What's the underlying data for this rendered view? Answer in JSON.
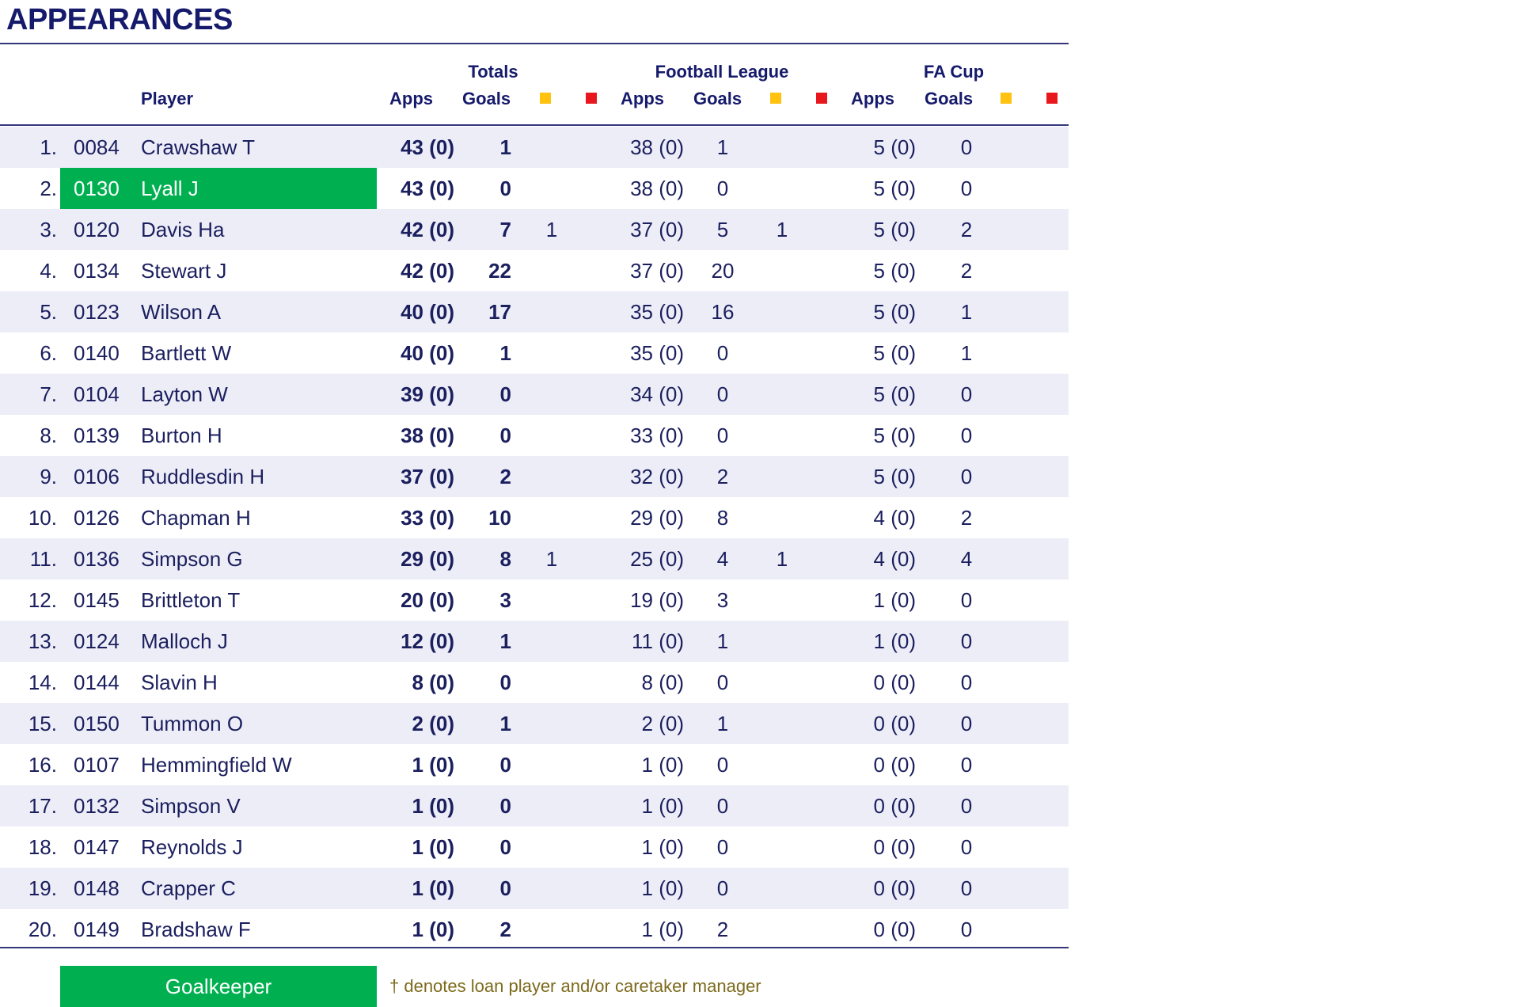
{
  "title": "APPEARANCES",
  "headers": {
    "player": "Player",
    "totals": "Totals",
    "league": "Football League",
    "cup": "FA Cup",
    "apps": "Apps",
    "goals": "Goals"
  },
  "colors": {
    "goalkeeper_band": "#00b050",
    "yellow_card": "#ffc20e",
    "red_card": "#e8171e",
    "text": "#1b1f5e",
    "row_alt": "#ededf8"
  },
  "rows": [
    {
      "rank": "1.",
      "code": "0084",
      "name": "Crawshaw T",
      "total_apps": "43 (0)",
      "total_goals": "1",
      "total_yellow": "",
      "league_apps": "38 (0)",
      "league_goals": "1",
      "league_yellow": "",
      "cup_apps": "5 (0)",
      "cup_goals": "0",
      "goalkeeper": false
    },
    {
      "rank": "2.",
      "code": "0130",
      "name": "Lyall J",
      "total_apps": "43 (0)",
      "total_goals": "0",
      "total_yellow": "",
      "league_apps": "38 (0)",
      "league_goals": "0",
      "league_yellow": "",
      "cup_apps": "5 (0)",
      "cup_goals": "0",
      "goalkeeper": true
    },
    {
      "rank": "3.",
      "code": "0120",
      "name": "Davis Ha",
      "total_apps": "42 (0)",
      "total_goals": "7",
      "total_yellow": "1",
      "league_apps": "37 (0)",
      "league_goals": "5",
      "league_yellow": "1",
      "cup_apps": "5 (0)",
      "cup_goals": "2",
      "goalkeeper": false
    },
    {
      "rank": "4.",
      "code": "0134",
      "name": "Stewart J",
      "total_apps": "42 (0)",
      "total_goals": "22",
      "total_yellow": "",
      "league_apps": "37 (0)",
      "league_goals": "20",
      "league_yellow": "",
      "cup_apps": "5 (0)",
      "cup_goals": "2",
      "goalkeeper": false
    },
    {
      "rank": "5.",
      "code": "0123",
      "name": "Wilson A",
      "total_apps": "40 (0)",
      "total_goals": "17",
      "total_yellow": "",
      "league_apps": "35 (0)",
      "league_goals": "16",
      "league_yellow": "",
      "cup_apps": "5 (0)",
      "cup_goals": "1",
      "goalkeeper": false
    },
    {
      "rank": "6.",
      "code": "0140",
      "name": "Bartlett W",
      "total_apps": "40 (0)",
      "total_goals": "1",
      "total_yellow": "",
      "league_apps": "35 (0)",
      "league_goals": "0",
      "league_yellow": "",
      "cup_apps": "5 (0)",
      "cup_goals": "1",
      "goalkeeper": false
    },
    {
      "rank": "7.",
      "code": "0104",
      "name": "Layton W",
      "total_apps": "39 (0)",
      "total_goals": "0",
      "total_yellow": "",
      "league_apps": "34 (0)",
      "league_goals": "0",
      "league_yellow": "",
      "cup_apps": "5 (0)",
      "cup_goals": "0",
      "goalkeeper": false
    },
    {
      "rank": "8.",
      "code": "0139",
      "name": "Burton H",
      "total_apps": "38 (0)",
      "total_goals": "0",
      "total_yellow": "",
      "league_apps": "33 (0)",
      "league_goals": "0",
      "league_yellow": "",
      "cup_apps": "5 (0)",
      "cup_goals": "0",
      "goalkeeper": false
    },
    {
      "rank": "9.",
      "code": "0106",
      "name": "Ruddlesdin H",
      "total_apps": "37 (0)",
      "total_goals": "2",
      "total_yellow": "",
      "league_apps": "32 (0)",
      "league_goals": "2",
      "league_yellow": "",
      "cup_apps": "5 (0)",
      "cup_goals": "0",
      "goalkeeper": false
    },
    {
      "rank": "10.",
      "code": "0126",
      "name": "Chapman H",
      "total_apps": "33 (0)",
      "total_goals": "10",
      "total_yellow": "",
      "league_apps": "29 (0)",
      "league_goals": "8",
      "league_yellow": "",
      "cup_apps": "4 (0)",
      "cup_goals": "2",
      "goalkeeper": false
    },
    {
      "rank": "11.",
      "code": "0136",
      "name": "Simpson G",
      "total_apps": "29 (0)",
      "total_goals": "8",
      "total_yellow": "1",
      "league_apps": "25 (0)",
      "league_goals": "4",
      "league_yellow": "1",
      "cup_apps": "4 (0)",
      "cup_goals": "4",
      "goalkeeper": false
    },
    {
      "rank": "12.",
      "code": "0145",
      "name": "Brittleton T",
      "total_apps": "20 (0)",
      "total_goals": "3",
      "total_yellow": "",
      "league_apps": "19 (0)",
      "league_goals": "3",
      "league_yellow": "",
      "cup_apps": "1 (0)",
      "cup_goals": "0",
      "goalkeeper": false
    },
    {
      "rank": "13.",
      "code": "0124",
      "name": "Malloch J",
      "total_apps": "12 (0)",
      "total_goals": "1",
      "total_yellow": "",
      "league_apps": "11 (0)",
      "league_goals": "1",
      "league_yellow": "",
      "cup_apps": "1 (0)",
      "cup_goals": "0",
      "goalkeeper": false
    },
    {
      "rank": "14.",
      "code": "0144",
      "name": "Slavin H",
      "total_apps": "8 (0)",
      "total_goals": "0",
      "total_yellow": "",
      "league_apps": "8 (0)",
      "league_goals": "0",
      "league_yellow": "",
      "cup_apps": "0 (0)",
      "cup_goals": "0",
      "goalkeeper": false
    },
    {
      "rank": "15.",
      "code": "0150",
      "name": "Tummon O",
      "total_apps": "2 (0)",
      "total_goals": "1",
      "total_yellow": "",
      "league_apps": "2 (0)",
      "league_goals": "1",
      "league_yellow": "",
      "cup_apps": "0 (0)",
      "cup_goals": "0",
      "goalkeeper": false
    },
    {
      "rank": "16.",
      "code": "0107",
      "name": "Hemmingfield W",
      "total_apps": "1 (0)",
      "total_goals": "0",
      "total_yellow": "",
      "league_apps": "1 (0)",
      "league_goals": "0",
      "league_yellow": "",
      "cup_apps": "0 (0)",
      "cup_goals": "0",
      "goalkeeper": false
    },
    {
      "rank": "17.",
      "code": "0132",
      "name": "Simpson V",
      "total_apps": "1 (0)",
      "total_goals": "0",
      "total_yellow": "",
      "league_apps": "1 (0)",
      "league_goals": "0",
      "league_yellow": "",
      "cup_apps": "0 (0)",
      "cup_goals": "0",
      "goalkeeper": false
    },
    {
      "rank": "18.",
      "code": "0147",
      "name": "Reynolds J",
      "total_apps": "1 (0)",
      "total_goals": "0",
      "total_yellow": "",
      "league_apps": "1 (0)",
      "league_goals": "0",
      "league_yellow": "",
      "cup_apps": "0 (0)",
      "cup_goals": "0",
      "goalkeeper": false
    },
    {
      "rank": "19.",
      "code": "0148",
      "name": "Crapper C",
      "total_apps": "1 (0)",
      "total_goals": "0",
      "total_yellow": "",
      "league_apps": "1 (0)",
      "league_goals": "0",
      "league_yellow": "",
      "cup_apps": "0 (0)",
      "cup_goals": "0",
      "goalkeeper": false
    },
    {
      "rank": "20.",
      "code": "0149",
      "name": "Bradshaw F",
      "total_apps": "1 (0)",
      "total_goals": "2",
      "total_yellow": "",
      "league_apps": "1 (0)",
      "league_goals": "2",
      "league_yellow": "",
      "cup_apps": "0 (0)",
      "cup_goals": "0",
      "goalkeeper": false
    }
  ],
  "legend": {
    "goalkeeper": "Goalkeeper",
    "note": "† denotes loan player and/or caretaker manager"
  }
}
